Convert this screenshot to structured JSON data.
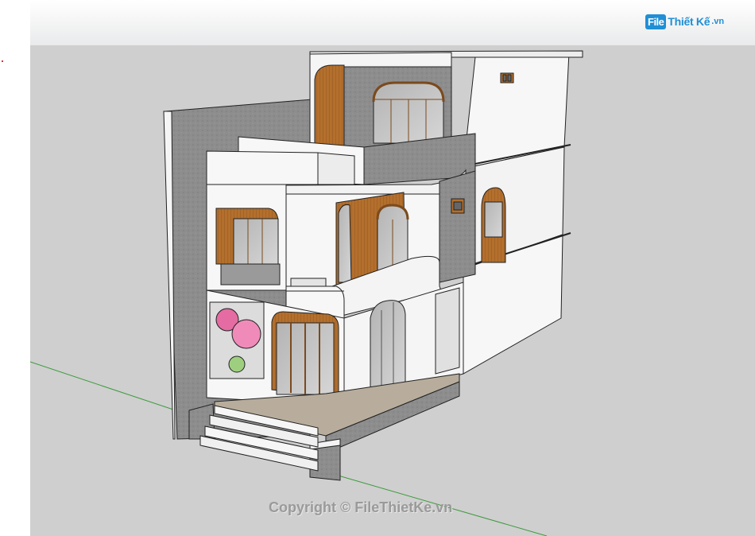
{
  "logo": {
    "mark": "File",
    "name": "Thiết Kế",
    "domain": ".vn"
  },
  "watermark": "Copyright © FileThietKe.vn",
  "colors": {
    "sky_top": "#ffffff",
    "sky_bottom": "#e9eaeb",
    "ground": "#cfcfcf",
    "wall_white": "#f7f7f7",
    "wall_grey": "#8e8e8e",
    "wood": "#b8742e",
    "axis_green": "#3c9a3c",
    "brand_blue": "#1f8fd6"
  }
}
